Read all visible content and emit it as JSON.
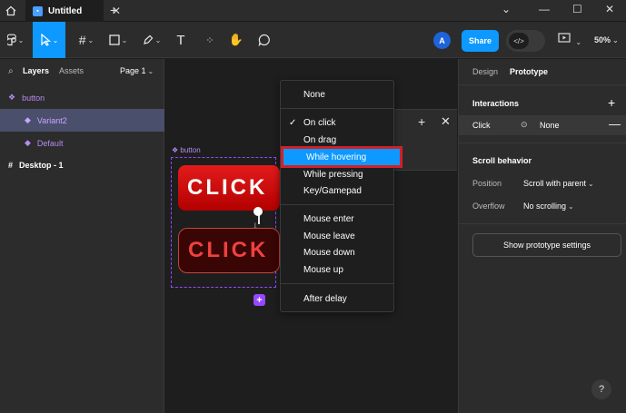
{
  "titlebar": {
    "tab_title": "Untitled",
    "tab_close": "✕",
    "tab_add": "+",
    "minimize": "—",
    "maximize": "☐",
    "close": "✕",
    "collapse": "⌄"
  },
  "toolbar": {
    "avatar_initial": "A",
    "share_label": "Share",
    "dev_mode_label": "</>",
    "zoom": "50%"
  },
  "left_panel": {
    "tabs": {
      "layers": "Layers",
      "assets": "Assets",
      "page": "Page 1"
    },
    "layers": [
      {
        "label": "button",
        "icon": "component-set-icon",
        "color": "#b58cf0"
      },
      {
        "label": "Variant2",
        "icon": "variant-icon",
        "color": "#b58cf0",
        "selected": true
      },
      {
        "label": "Default",
        "icon": "variant-icon",
        "color": "#b58cf0"
      },
      {
        "label": "Desktop - 1",
        "icon": "frame-icon",
        "color": "#ffffff"
      }
    ]
  },
  "canvas": {
    "frame_label": "button",
    "button_text_1": "CLICK",
    "button_text_2": "CLICK",
    "add_variant": "+"
  },
  "trigger_menu": {
    "items": [
      {
        "label": "None"
      },
      {
        "label": "On click",
        "checked": true
      },
      {
        "label": "On drag"
      },
      {
        "label": "While hovering",
        "highlighted": true
      },
      {
        "label": "While pressing"
      },
      {
        "label": "Key/Gamepad"
      },
      {
        "label": "Mouse enter"
      },
      {
        "label": "Mouse leave"
      },
      {
        "label": "Mouse down"
      },
      {
        "label": "Mouse up"
      },
      {
        "label": "After delay"
      }
    ]
  },
  "right_panel": {
    "tabs": {
      "design": "Design",
      "prototype": "Prototype"
    },
    "interactions_title": "Interactions",
    "interaction": {
      "trigger": "Click",
      "action": "None"
    },
    "scroll_title": "Scroll behavior",
    "position_label": "Position",
    "position_value": "Scroll with parent",
    "overflow_label": "Overflow",
    "overflow_value": "No scrolling",
    "show_settings": "Show prototype settings",
    "help": "?"
  },
  "colors": {
    "accent": "#0d99ff",
    "component": "#9747ff",
    "highlight_border": "#d32027",
    "button_red": "#e31b1b"
  }
}
